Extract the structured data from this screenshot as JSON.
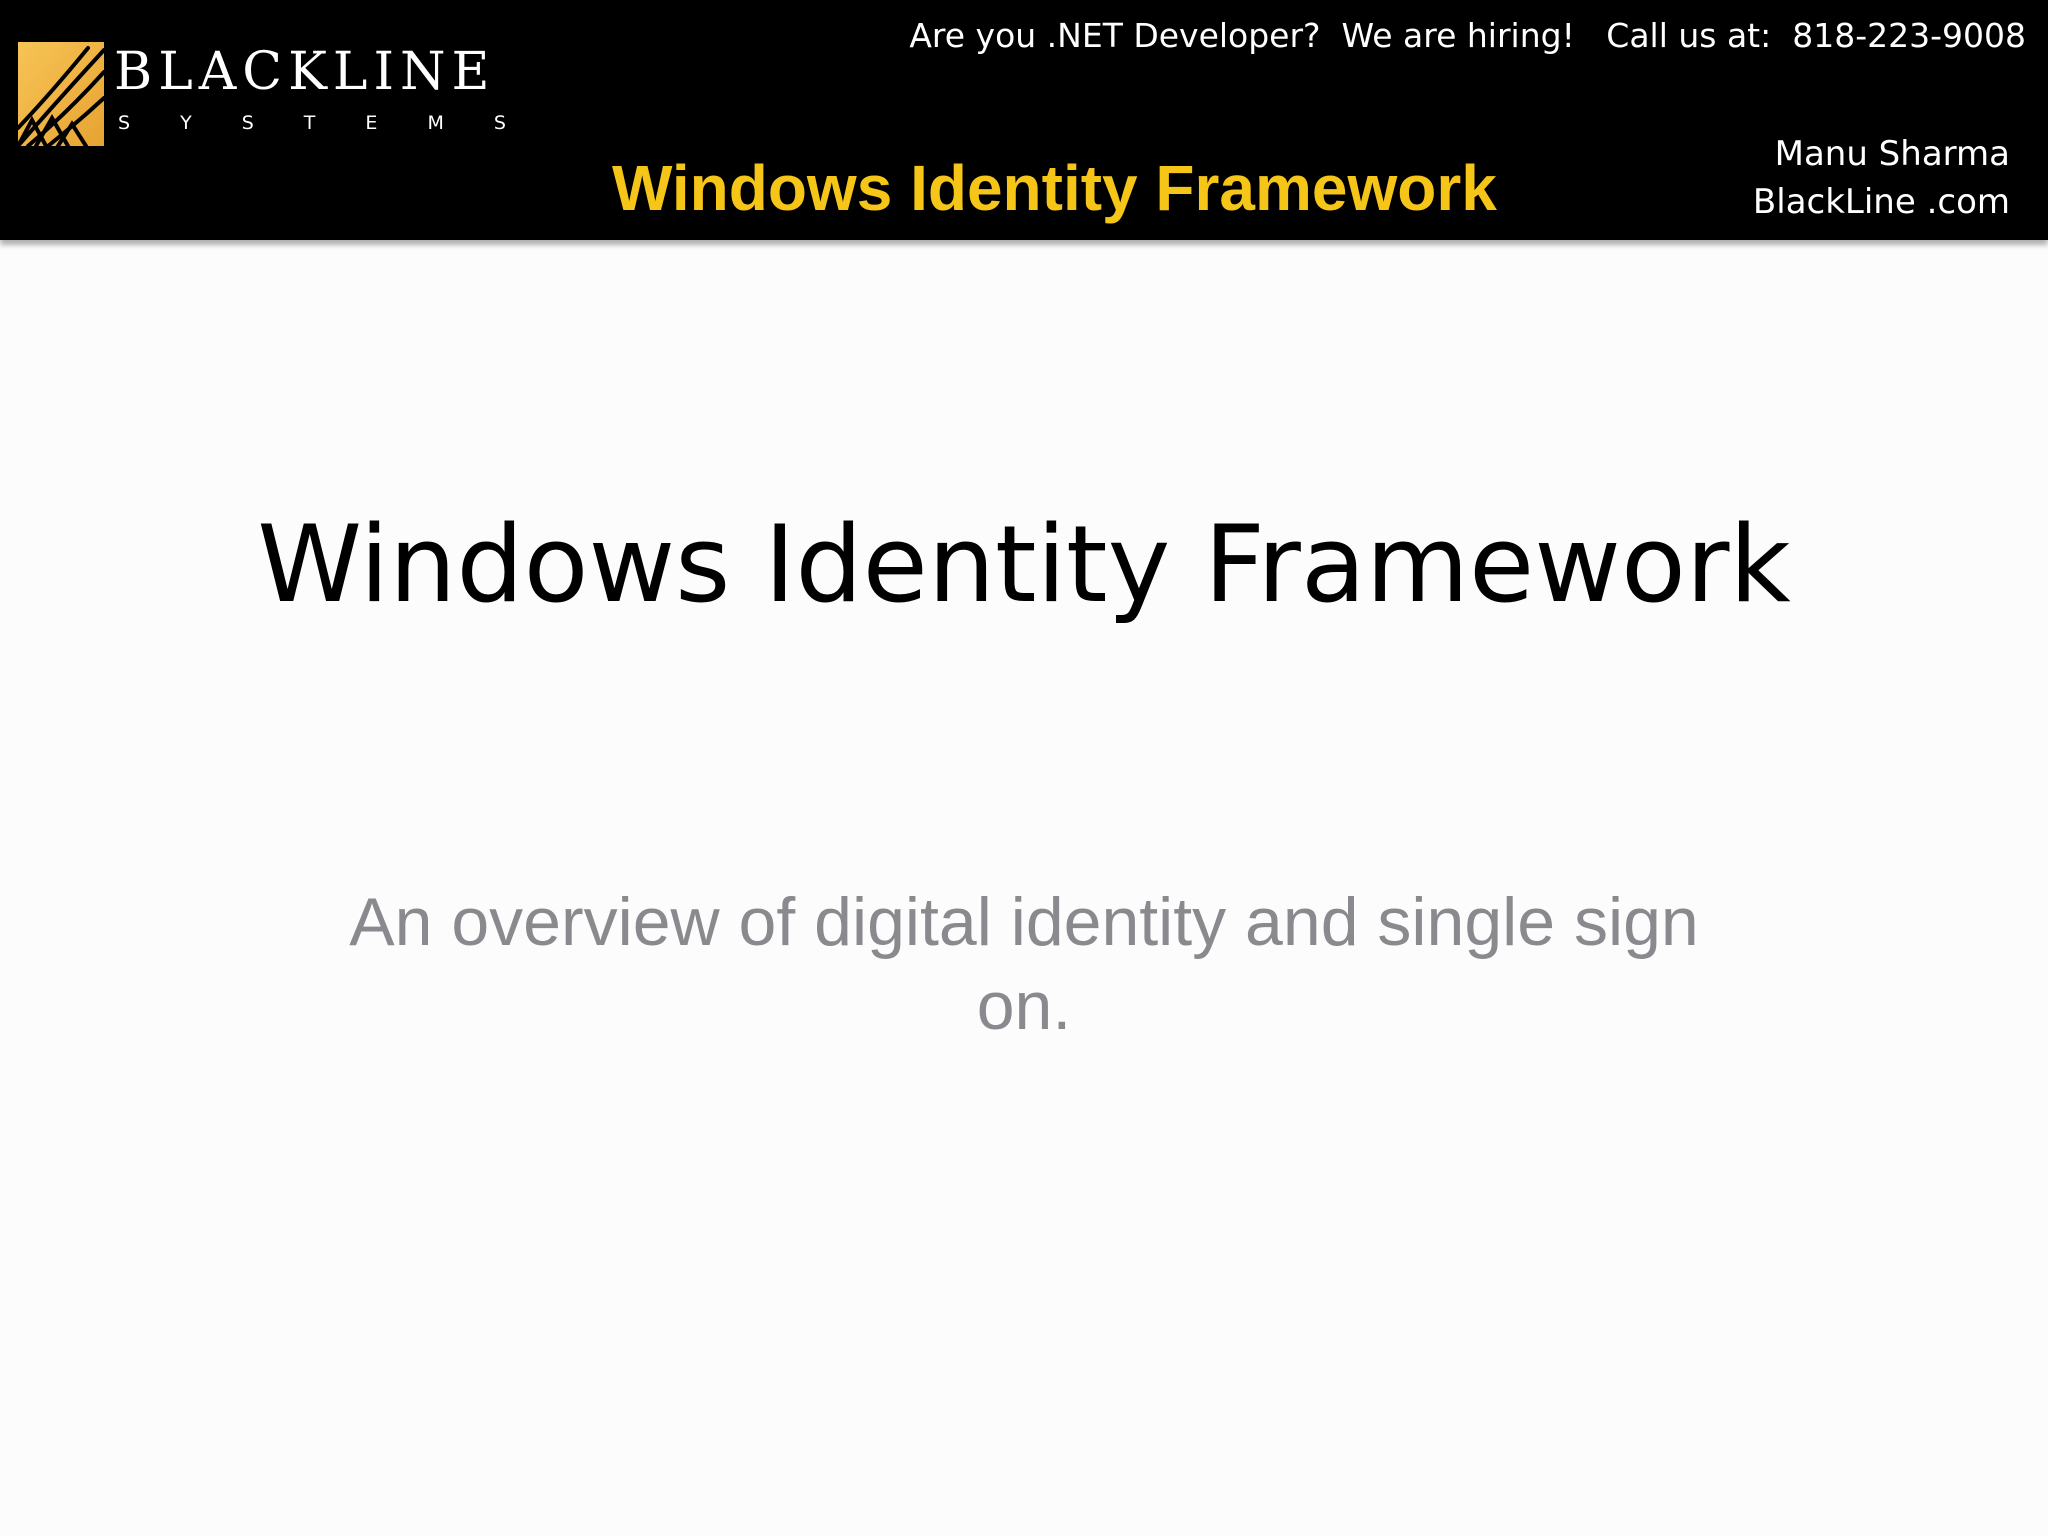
{
  "header": {
    "hiring_text": "Are you .NET Developer?  We are hiring!   Call us at:  818-223-9008",
    "title": "Windows Identity Framework",
    "presenter_name": "Manu Sharma",
    "presenter_site": "BlackLine .com",
    "title_color": "#f5c518"
  },
  "logo": {
    "wordmark": "BLACKLINE",
    "tagline_letters": [
      "S",
      "Y",
      "S",
      "T",
      "E",
      "M",
      "S"
    ],
    "mark_color": "#f0b43c"
  },
  "slide": {
    "title": "Windows Identity Framework",
    "subtitle": "An overview of digital identity and single sign on."
  }
}
